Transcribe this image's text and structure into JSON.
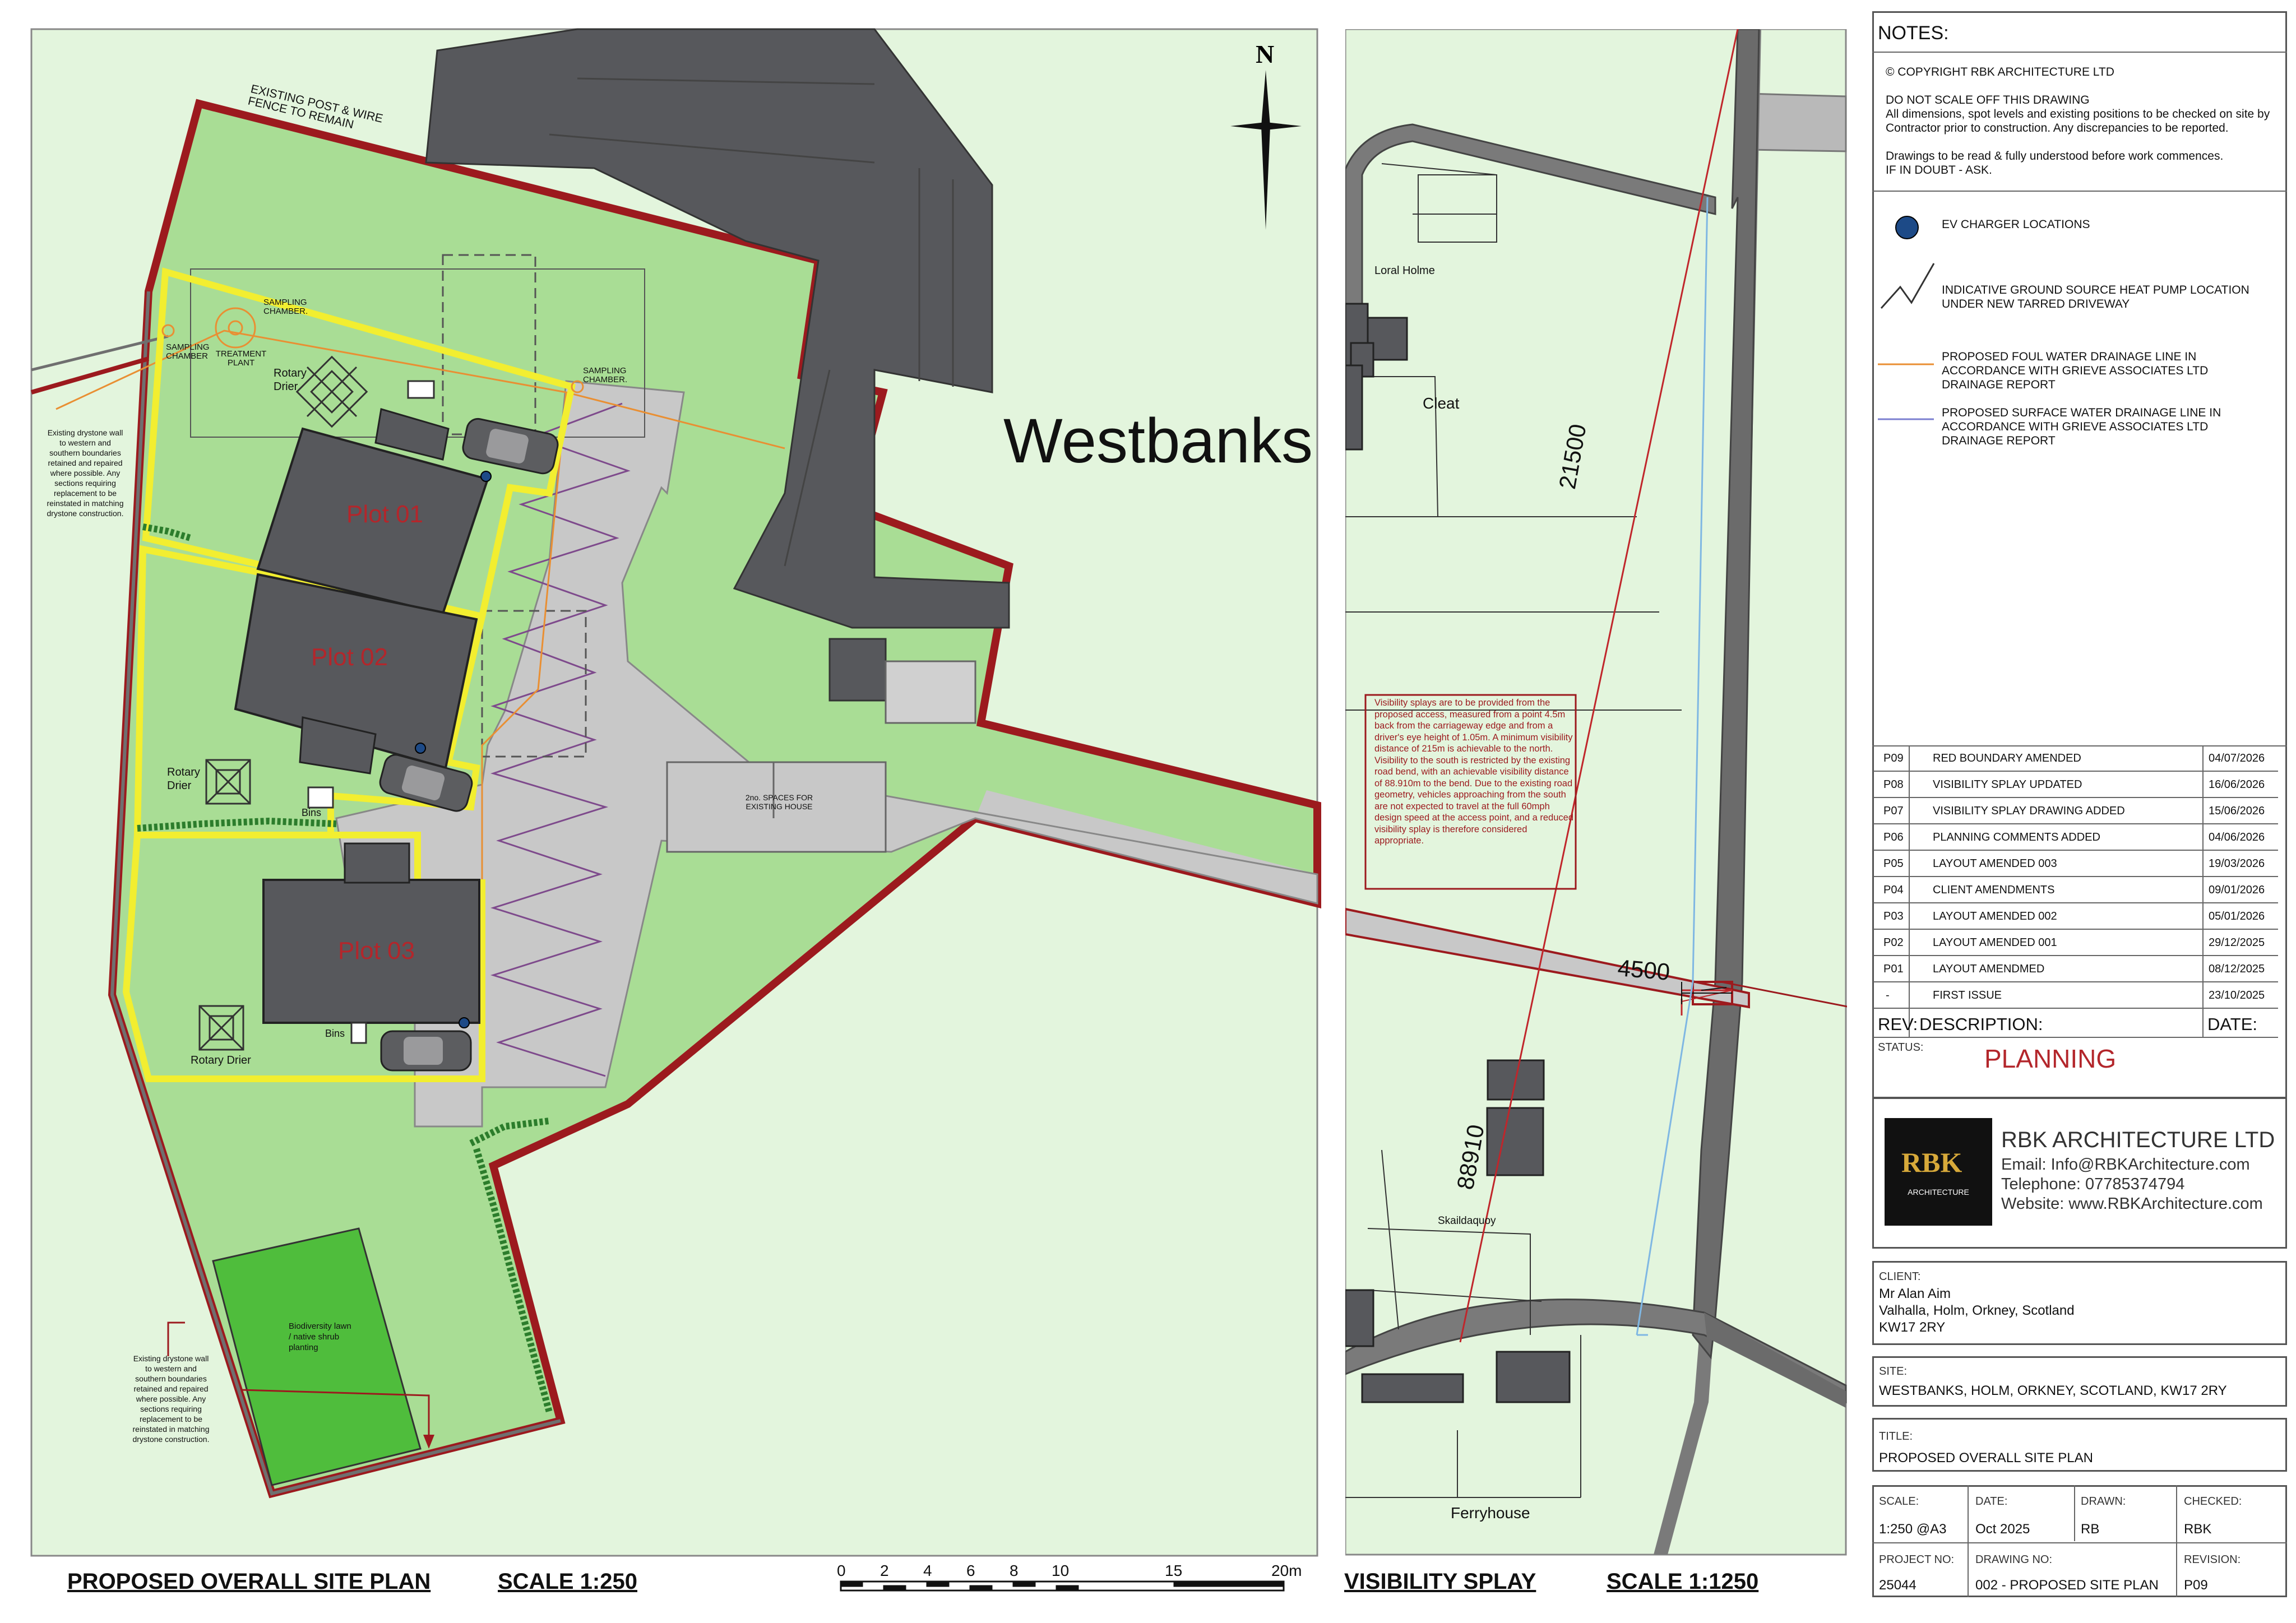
{
  "site_plan": {
    "place_name": "Westbanks",
    "plots": [
      "Plot 01",
      "Plot 02",
      "Plot 03"
    ],
    "labels": {
      "fence": "EXISTING POST & WIRE FENCE TO REMAIN",
      "sampling_1": "SAMPLING CHAMBER.",
      "sampling_2": "SAMPLING CHAMBER",
      "sampling_3": "SAMPLING CHAMBER.",
      "treatment": "TREATMENT PLANT",
      "rotary_1": "Rotary Drier",
      "rotary_2": "Rotary Drier",
      "rotary_3": "Rotary Drier",
      "bins_1": "Bins",
      "bins_2": "Bins",
      "spaces": "2no. SPACES FOR EXISTING HOUSE",
      "biodiversity": "Biodiversity lawn / native shrub planting",
      "drystone_note": "Existing drystone wall to western and southern boundaries retained and repaired where possible. Any sections requiring replacement to be reinstated in matching drystone construction."
    },
    "title": "PROPOSED OVERALL SITE PLAN",
    "scale": "SCALE 1:250",
    "scale_bar_ticks": [
      "0",
      "2",
      "4",
      "6",
      "8",
      "10",
      "15",
      "20m"
    ]
  },
  "visibility": {
    "labels": {
      "loral_holme": "Loral Holme",
      "cleat": "Cleat",
      "skaildaquoy": "Skaildaquoy",
      "ferryhouse": "Ferryhouse",
      "dim_north": "21500",
      "dim_access": "4500",
      "dim_south": "88910"
    },
    "note": "Visibility splays are to be provided from the proposed access, measured from a point 4.5m back from the carriageway edge and from a driver's eye height of 1.05m. A minimum visibility distance of 215m is achievable to the north. Visibility to the south is restricted by the existing road bend, with an achievable visibility distance of 88.910m to the bend. Due to the existing road geometry, vehicles approaching from the south are not expected to travel at the full 60mph design speed at the access point, and a reduced visibility splay is therefore considered appropriate.",
    "title": "VISIBILITY SPLAY",
    "scale": "SCALE 1:1250"
  },
  "title_block": {
    "notes_heading": "NOTES:",
    "notes_lines": [
      "© COPYRIGHT RBK ARCHITECTURE LTD",
      "",
      "DO NOT SCALE OFF THIS DRAWING",
      "All dimensions, spot levels and existing positions to be checked on site by",
      "Contractor prior to construction. Any discrepancies to be reported.",
      "",
      "Drawings to be read & fully understood before work commences.",
      "IF IN DOUBT - ASK."
    ],
    "legend": {
      "ev": "EV CHARGER LOCATIONS",
      "gshp": "INDICATIVE GROUND SOURCE HEAT PUMP LOCATION UNDER NEW TARRED DRIVEWAY",
      "foul": "PROPOSED FOUL WATER DRAINAGE LINE IN ACCORDANCE WITH GRIEVE ASSOCIATES LTD DRAINAGE REPORT",
      "surface": "PROPOSED SURFACE WATER DRAINAGE LINE IN ACCORDANCE WITH GRIEVE ASSOCIATES LTD DRAINAGE REPORT"
    },
    "revisions": [
      {
        "rev": "P09",
        "desc": "RED BOUNDARY AMENDED",
        "date": "04/07/2026"
      },
      {
        "rev": "P08",
        "desc": "VISIBILITY SPLAY UPDATED",
        "date": "16/06/2026"
      },
      {
        "rev": "P07",
        "desc": "VISIBILITY SPLAY DRAWING ADDED",
        "date": "15/06/2026"
      },
      {
        "rev": "P06",
        "desc": "PLANNING COMMENTS ADDED",
        "date": "04/06/2026"
      },
      {
        "rev": "P05",
        "desc": "LAYOUT AMENDED 003",
        "date": "19/03/2026"
      },
      {
        "rev": "P04",
        "desc": "CLIENT AMENDMENTS",
        "date": "09/01/2026"
      },
      {
        "rev": "P03",
        "desc": "LAYOUT AMENDED 002",
        "date": "05/01/2026"
      },
      {
        "rev": "P02",
        "desc": "LAYOUT AMENDED 001",
        "date": "29/12/2025"
      },
      {
        "rev": "P01",
        "desc": "LAYOUT AMENDMED",
        "date": "08/12/2025"
      },
      {
        "rev": "-",
        "desc": "FIRST ISSUE",
        "date": "23/10/2025"
      }
    ],
    "rev_header": {
      "rev": "REV:",
      "desc": "DESCRIPTION:",
      "date": "DATE:"
    },
    "status_label": "STATUS:",
    "status": "PLANNING",
    "company": {
      "name": "RBK ARCHITECTURE LTD",
      "email": "Email: Info@RBKArchitecture.com",
      "phone": "Telephone: 07785374794",
      "web": "Website: www.RBKArchitecture.com",
      "logo_text": "RBK",
      "logo_sub": "ARCHITECTURE"
    },
    "client_label": "CLIENT:",
    "client_lines": [
      "Mr Alan Aim",
      "Valhalla, Holm, Orkney, Scotland",
      "KW17 2RY"
    ],
    "site_label": "SITE:",
    "site": "WESTBANKS, HOLM, ORKNEY, SCOTLAND, KW17 2RY",
    "title_label": "TITLE:",
    "title": "PROPOSED OVERALL SITE PLAN",
    "fields": {
      "scale_label": "SCALE:",
      "scale": "1:250 @A3",
      "date_label": "DATE:",
      "date": "Oct 2025",
      "drawn_label": "DRAWN:",
      "drawn": "RB",
      "checked_label": "CHECKED:",
      "checked": "RBK",
      "project_label": "PROJECT NO:",
      "project": "25044",
      "drawing_label": "DRAWING NO:",
      "drawing": "002 - PROPOSED SITE PLAN",
      "revision_label": "REVISION:",
      "revision": "P09"
    }
  },
  "colors": {
    "lawn": "#b3e2a0",
    "field": "#e3f5dd",
    "building": "#57585c",
    "boundary": "#9c1a1e",
    "plot_outline": "#f2ee30",
    "driveway": "#c8c8c8",
    "status": "#b3262b",
    "biodiversity": "#4fbd3c"
  }
}
